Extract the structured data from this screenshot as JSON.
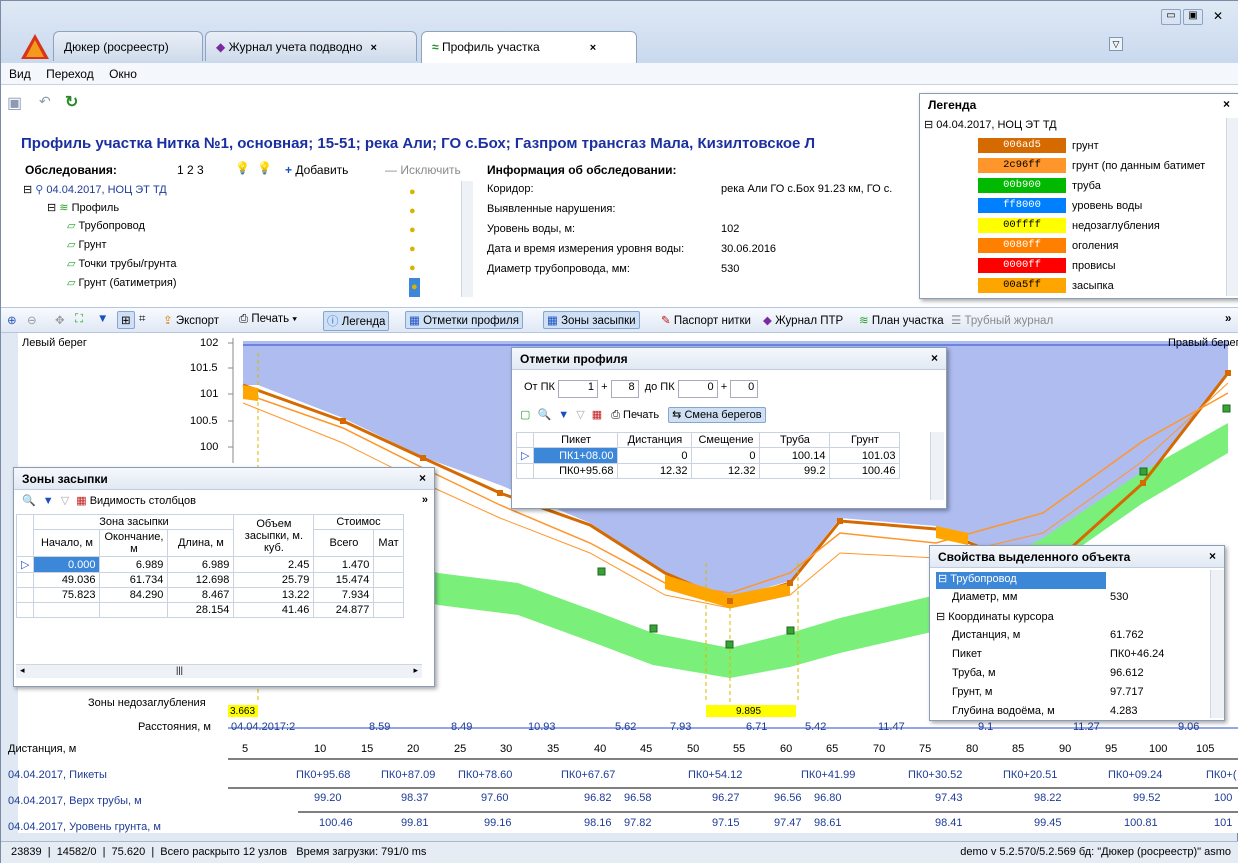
{
  "tabs": [
    {
      "label": "Дюкер (росреестр)"
    },
    {
      "label": "Журнал учета подводно"
    },
    {
      "label": "Профиль участка"
    }
  ],
  "menu": [
    "Вид",
    "Переход",
    "Окно"
  ],
  "page_title": "Профиль участка  Нитка №1, основная; 15-51; река Али; ГО с.Бох; Газпром трансгаз Мала, Кизилтовское Л",
  "surveys": {
    "label": "Обследования:",
    "pages": "1  2  3",
    "add": "Добавить",
    "exclude": "Исключить",
    "tree": {
      "root": "04.04.2017, НОЦ ЭТ ТД",
      "profile": "Профиль",
      "items": [
        "Трубопровод",
        "Грунт",
        "Точки трубы/грунта",
        "Грунт (батиметрия)"
      ]
    }
  },
  "info": {
    "title": "Информация об обследовании:",
    "rows": [
      {
        "k": "Коридор:",
        "v": "река Али ГО с.Бох 91.23 км, ГО с."
      },
      {
        "k": "Выявленные нарушения:",
        "v": ""
      },
      {
        "k": "Уровень воды, м:",
        "v": "102"
      },
      {
        "k": "Дата и время измерения уровня воды:",
        "v": "30.06.2016"
      },
      {
        "k": "Диаметр трубопровода, мм:",
        "v": "530"
      }
    ]
  },
  "legend": {
    "title": "Легенда",
    "root": "04.04.2017, НОЦ ЭТ ТД",
    "items": [
      {
        "code": "006ad5",
        "label": "грунт",
        "color": "#d56a00",
        "fg": "#ffffff"
      },
      {
        "code": "2c96ff",
        "label": "грунт (по данным батимет",
        "color": "#ff962c",
        "fg": "#000000"
      },
      {
        "code": "00b900",
        "label": "труба",
        "color": "#00b900",
        "fg": "#ffffff"
      },
      {
        "code": "ff8000",
        "label": "уровень воды",
        "color": "#0080ff",
        "fg": "#ffffff"
      },
      {
        "code": "00ffff",
        "label": "недозаглубления",
        "color": "#ffff00",
        "fg": "#000000"
      },
      {
        "code": "0080ff",
        "label": "оголения",
        "color": "#ff8000",
        "fg": "#ffffff"
      },
      {
        "code": "0000ff",
        "label": "провисы",
        "color": "#ff0000",
        "fg": "#ffffff"
      },
      {
        "code": "00a5ff",
        "label": "засыпка",
        "color": "#ffa500",
        "fg": "#000000"
      }
    ]
  },
  "toolbar": {
    "export": "Экспорт",
    "print": "Печать",
    "legend": "Легенда",
    "profile_marks": "Отметки профиля",
    "fill_zones": "Зоны засыпки",
    "passport": "Паспорт нитки",
    "ptr_journal": "Журнал ПТР",
    "site_plan": "План участка",
    "pipe_journal": "Трубный журнал"
  },
  "chart": {
    "left_bank": "Левый берег",
    "right_bank": "Правый берег",
    "y_ticks": [
      "102",
      "101.5",
      "101",
      "100.5",
      "100"
    ],
    "underdepth_label": "Зоны недозаглубления",
    "underdepth_values": [
      "3.663",
      "9.895"
    ],
    "distances_label": "Расстояния, м",
    "distances": [
      "04.04.2017:2",
      "8.59",
      "8.49",
      "10.93",
      "5.62",
      "7.93",
      "6.71",
      "5.42",
      "11.47",
      "9.1",
      "11.27",
      "9.06"
    ],
    "dist_axis_label": "Дистанция, м",
    "dist_ticks": [
      "5",
      "10",
      "15",
      "20",
      "25",
      "30",
      "35",
      "40",
      "45",
      "50",
      "55",
      "60",
      "65",
      "70",
      "75",
      "80",
      "85",
      "90",
      "95",
      "100",
      "105"
    ],
    "pickets_label": "04.04.2017, Пикеты",
    "pickets": [
      "ПК0+95.68",
      "ПК0+87.09",
      "ПК0+78.60",
      "ПК0+67.67",
      "ПК0+54.12",
      "ПК0+41.99",
      "ПК0+30.52",
      "ПК0+20.51",
      "ПК0+09.24",
      "ПК0+("
    ],
    "pipe_top_label": "04.04.2017, Верх трубы, м",
    "pipe_top": [
      "99.20",
      "98.37",
      "97.60",
      "96.82",
      "96.58",
      "96.27",
      "96.56",
      "96.80",
      "97.43",
      "98.22",
      "99.52",
      "100"
    ],
    "ground_label": "04.04.2017, Уровень грунта, м",
    "ground": [
      "100.46",
      "99.81",
      "99.16",
      "98.16",
      "97.82",
      "97.15",
      "97.47",
      "98.61",
      "98.41",
      "99.45",
      "100.81",
      "101"
    ]
  },
  "marks_window": {
    "title": "Отметки профиля",
    "from_pk": "От ПК",
    "from_a": "1",
    "from_b": "8",
    "to_pk": "до ПК",
    "to_a": "0",
    "to_b": "0",
    "print": "Печать",
    "swap": "Смена берегов",
    "headers": [
      "Пикет",
      "Дистанция",
      "Смещение",
      "Труба",
      "Грунт"
    ],
    "rows": [
      [
        "ПК1+08.00",
        "0",
        "0",
        "100.14",
        "101.03"
      ],
      [
        "ПК0+95.68",
        "12.32",
        "12.32",
        "99.2",
        "100.46"
      ]
    ]
  },
  "fill_window": {
    "title": "Зоны засыпки",
    "col_visibility": "Видимость столбцов",
    "group1": "Зона засыпки",
    "group2": "Стоимос",
    "headers": [
      "Начало, м",
      "Окончание, м",
      "Длина, м",
      "Объем засыпки, м. куб.",
      "Всего",
      "Мат"
    ],
    "rows": [
      [
        "0.000",
        "6.989",
        "6.989",
        "2.45",
        "1.470"
      ],
      [
        "49.036",
        "61.734",
        "12.698",
        "25.79",
        "15.474"
      ],
      [
        "75.823",
        "84.290",
        "8.467",
        "13.22",
        "7.934"
      ]
    ],
    "totals": [
      "",
      "",
      "28.154",
      "41.46",
      "24.877"
    ]
  },
  "props_window": {
    "title": "Свойства выделенного объекта",
    "rows": [
      {
        "k": "Трубопровод",
        "v": "",
        "level": 0
      },
      {
        "k": "Диаметр, мм",
        "v": "530",
        "level": 1
      },
      {
        "k": "Координаты курсора",
        "v": "",
        "level": 0
      },
      {
        "k": "Дистанция, м",
        "v": "61.762",
        "level": 1
      },
      {
        "k": "Пикет",
        "v": "ПК0+46.24",
        "level": 1
      },
      {
        "k": "Труба, м",
        "v": "96.612",
        "level": 1
      },
      {
        "k": "Грунт, м",
        "v": "97.717",
        "level": 1
      },
      {
        "k": "Глубина водоёма, м",
        "v": "4.283",
        "level": 1
      }
    ]
  },
  "status": {
    "a": "23839",
    "b": "14582/0",
    "c": "75.620",
    "nodes": "Всего раскрыто 12 узлов",
    "load": "Время загрузки: 791/0 ms",
    "right": "demo  v 5.2.570/5.2.569  бд: \"Дюкер (росреестр)\" asmo"
  }
}
